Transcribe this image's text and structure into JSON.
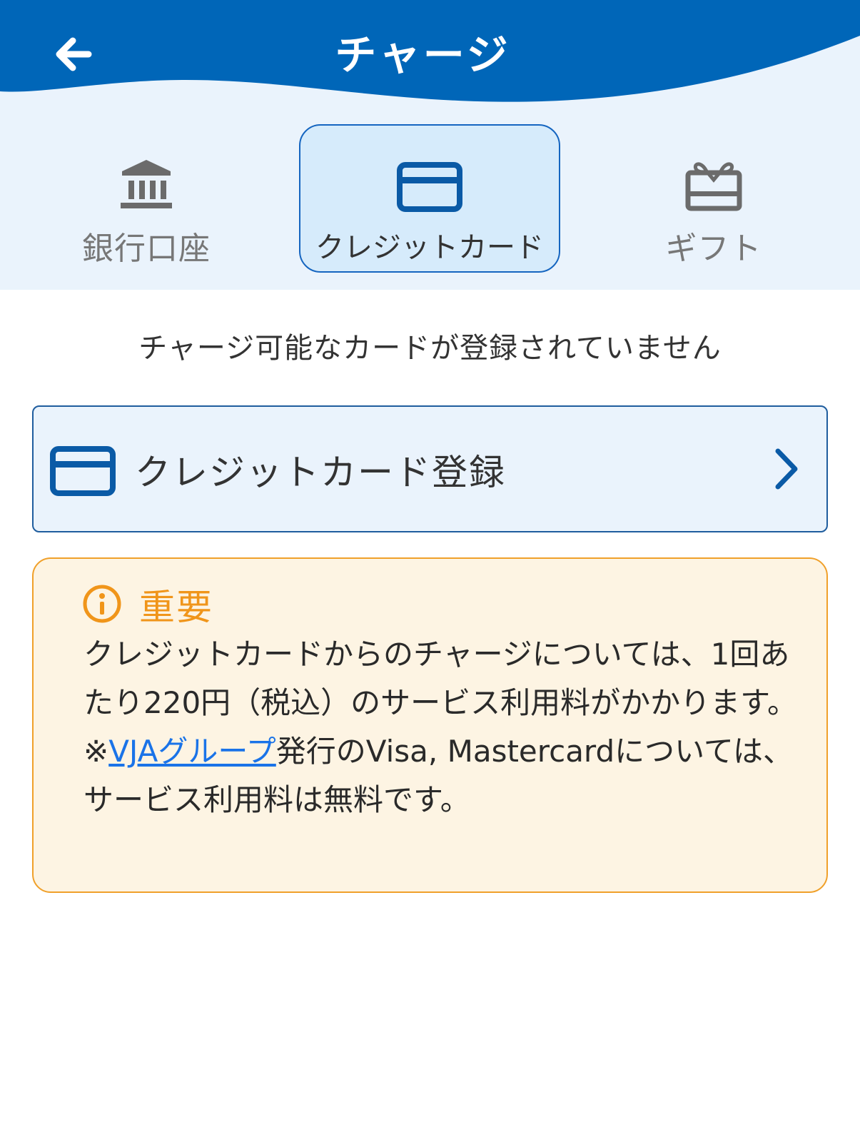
{
  "header": {
    "title": "チャージ",
    "background_color": "#0066b8"
  },
  "tabs": [
    {
      "label": "銀行口座",
      "icon": "bank-icon",
      "selected": false
    },
    {
      "label": "クレジットカード",
      "icon": "credit-card-icon",
      "selected": true
    },
    {
      "label": "ギフト",
      "icon": "gift-icon",
      "selected": false
    }
  ],
  "notice": "チャージ可能なカードが登録されていません",
  "register": {
    "label": "クレジットカード登録",
    "icon": "credit-card-icon"
  },
  "important": {
    "title": "重要",
    "icon": "info-icon",
    "accent_color": "#f0951a",
    "fee_text": "クレジットカードからのチャージについては、1回あたり220円（税込）のサービス利用料がかかります。",
    "note_prefix": "※",
    "note_link": "VJAグループ",
    "note_rest": "発行のVisa, Mastercardについては、サービス利用料は無料です。"
  },
  "colors": {
    "primary": "#0066b8",
    "selected_tab_bg": "#d6ebfb",
    "link": "#1a73e8"
  }
}
